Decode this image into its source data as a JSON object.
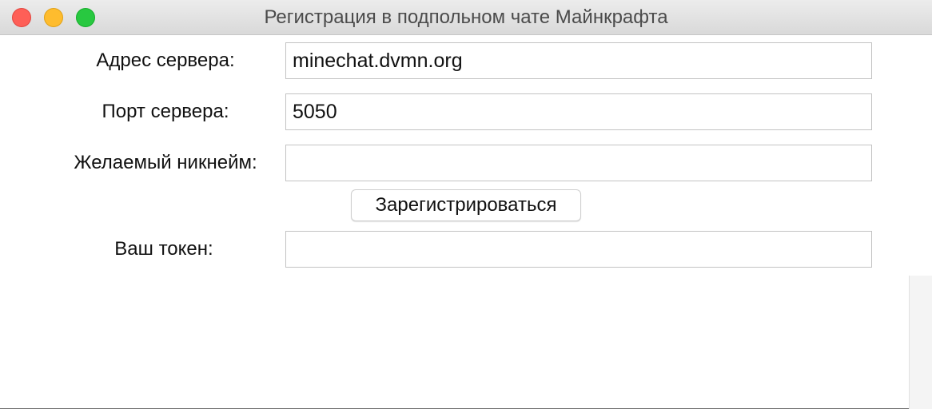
{
  "window": {
    "title": "Регистрация в подпольном чате Майнкрафта",
    "controls": {
      "close_color": "#fe5f57",
      "minimize_color": "#febc2e",
      "maximize_color": "#28c840"
    }
  },
  "form": {
    "server_address": {
      "label": "Адрес сервера:",
      "value": "minechat.dvmn.org"
    },
    "server_port": {
      "label": "Порт сервера:",
      "value": "5050"
    },
    "nickname": {
      "label": "Желаемый никнейм:",
      "value": ""
    },
    "register_button": {
      "label": "Зарегистрироваться"
    },
    "token": {
      "label": "Ваш токен:",
      "value": ""
    }
  }
}
